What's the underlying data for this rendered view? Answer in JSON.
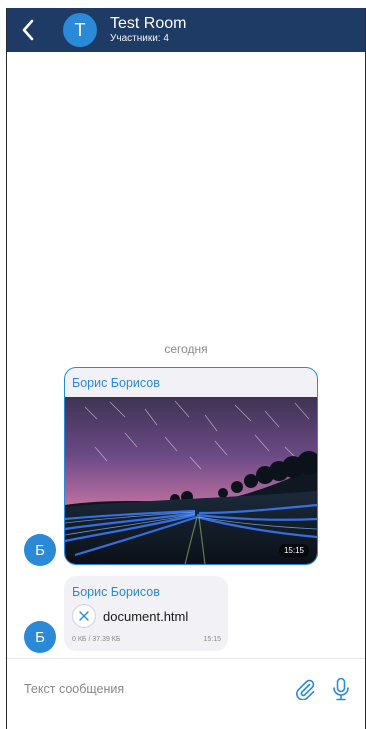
{
  "header": {
    "back_icon": "chevron-left-icon",
    "avatar_letter": "T",
    "title": "Test Room",
    "subtitle": "Участники: 4"
  },
  "chat": {
    "date_separator": "сегодня",
    "messages": [
      {
        "type": "image",
        "sender": "Борис Борисов",
        "avatar_letter": "Б",
        "time": "15:15"
      },
      {
        "type": "file",
        "sender": "Борис Борисов",
        "avatar_letter": "Б",
        "file_name": "document.html",
        "file_size": "0 КБ / 37.39 КБ",
        "time": "15:15",
        "icon": "cancel-download-icon"
      }
    ]
  },
  "composer": {
    "placeholder": "Текст сообщения",
    "value": "",
    "attach_icon": "paperclip-icon",
    "mic_icon": "microphone-icon"
  },
  "colors": {
    "header_bg": "#1e3b66",
    "accent": "#2a8ad8",
    "bubble_bg": "#f2f2f6"
  }
}
